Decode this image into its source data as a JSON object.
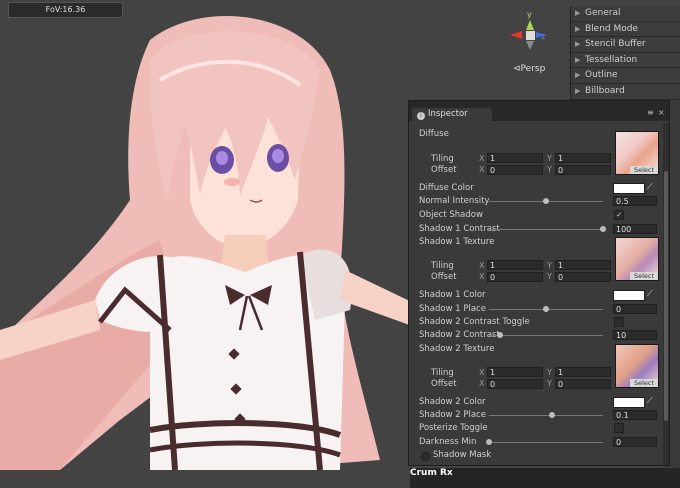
{
  "viewport": {
    "fov_label": "FoV:16.36",
    "projection_label": "Persp",
    "gizmo_axes": [
      "y",
      "z"
    ],
    "bottom_overlay": "Crum Rx"
  },
  "material_sections": [
    {
      "label": "General"
    },
    {
      "label": "Blend Mode"
    },
    {
      "label": "Stencil Buffer"
    },
    {
      "label": "Tessellation"
    },
    {
      "label": "Outline"
    },
    {
      "label": "Billboard"
    }
  ],
  "inspector": {
    "tab_title": "Inspector",
    "diffuse": {
      "label": "Diffuse",
      "tiling": {
        "label": "Tiling",
        "x": "1",
        "y": "1"
      },
      "offset": {
        "label": "Offset",
        "x": "0",
        "y": "0"
      },
      "select": "Select"
    },
    "diffuse_color": {
      "label": "Diffuse Color"
    },
    "normal_intensity": {
      "label": "Normal Intensity",
      "value": "0.5",
      "slider": 0.5
    },
    "object_shadow": {
      "label": "Object Shadow",
      "checked": true
    },
    "shadow1_contrast": {
      "label": "Shadow 1 Contrast",
      "value": "100",
      "slider": 1.0
    },
    "shadow1_texture": {
      "label": "Shadow 1 Texture",
      "tiling": {
        "label": "Tiling",
        "x": "1",
        "y": "1"
      },
      "offset": {
        "label": "Offset",
        "x": "0",
        "y": "0"
      },
      "select": "Select"
    },
    "shadow1_color": {
      "label": "Shadow 1 Color"
    },
    "shadow1_place": {
      "label": "Shadow 1 Place",
      "value": "0",
      "slider": 0.5
    },
    "shadow2_contrast_toggle": {
      "label": "Shadow 2 Contrast Toggle",
      "checked": false
    },
    "shadow2_contrast": {
      "label": "Shadow 2 Contrast",
      "value": "10",
      "slider": 0.1
    },
    "shadow2_texture": {
      "label": "Shadow 2 Texture",
      "tiling": {
        "label": "Tiling",
        "x": "1",
        "y": "1"
      },
      "offset": {
        "label": "Offset",
        "x": "0",
        "y": "0"
      },
      "select": "Select"
    },
    "shadow2_color": {
      "label": "Shadow 2 Color"
    },
    "shadow2_place": {
      "label": "Shadow 2 Place",
      "value": "0.1",
      "slider": 0.55
    },
    "posterize_toggle": {
      "label": "Posterize Toggle",
      "checked": false
    },
    "darkness_min": {
      "label": "Darkness Min",
      "value": "0",
      "slider": 0.0
    },
    "shadow_mask": {
      "label": "Shadow Mask"
    },
    "axis_x": "X",
    "axis_y": "Y"
  },
  "colors": {
    "panel": "#3a3a3a",
    "field": "#2b2b2b",
    "viewport": "#434343",
    "hair": "#f2c4c0",
    "dress": "#f7f3f3",
    "trim": "#4a2b2e"
  }
}
